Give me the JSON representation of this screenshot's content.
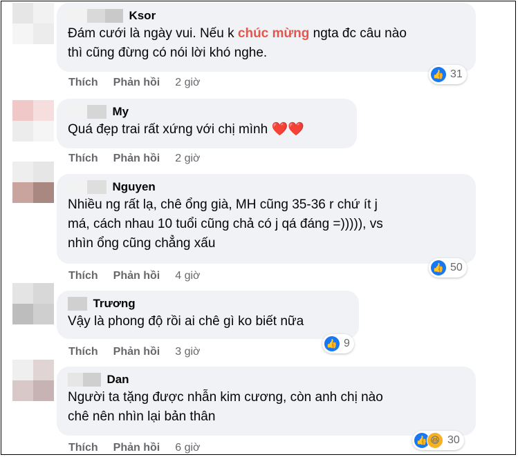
{
  "comments": [
    {
      "name": "Ksor",
      "text_pre": "Đám cưới là ngày vui. Nếu k ",
      "highlight": "chúc mừng",
      "text_post": " ngta đc câu nào\nthì cũng đừng có nói lời khó nghe.",
      "like": "Thích",
      "reply": "Phản hồi",
      "time": "2 giờ",
      "reactions": "31"
    },
    {
      "name": "My",
      "text": "Quá đẹp trai rất xứng với chị mình ❤️❤️",
      "like": "Thích",
      "reply": "Phản hồi",
      "time": "2 giờ"
    },
    {
      "name": "Nguyen",
      "text": "Nhiều ng rất lạ, chê ổng già, MH cũng 35-36 r chứ ít j\nmá, cách nhau 10 tuổi cũng chả có j qá đáng =))))), vs\nnhìn ổng cũng chẳng xấu",
      "like": "Thích",
      "reply": "Phản hồi",
      "time": "4 giờ",
      "reactions": "50"
    },
    {
      "name": "Trương",
      "text": "Vậy là phong độ rồi ai chê gì ko biết nữa",
      "like": "Thích",
      "reply": "Phản hồi",
      "time": "3 giờ",
      "reactions": "9"
    },
    {
      "name": "Dan",
      "text": "Người ta tặng được nhẫn kim cương, còn anh chị nào\nchê nên nhìn lại bản thân",
      "like": "Thích",
      "reply": "Phản hồi",
      "time": "6 giờ",
      "reactions": "30"
    }
  ],
  "icons": {
    "like": "like-icon",
    "haha": "haha-icon"
  },
  "colors": {
    "bubble": "#f0f2f5",
    "like": "#1877f2",
    "highlight": "#e0574f"
  }
}
